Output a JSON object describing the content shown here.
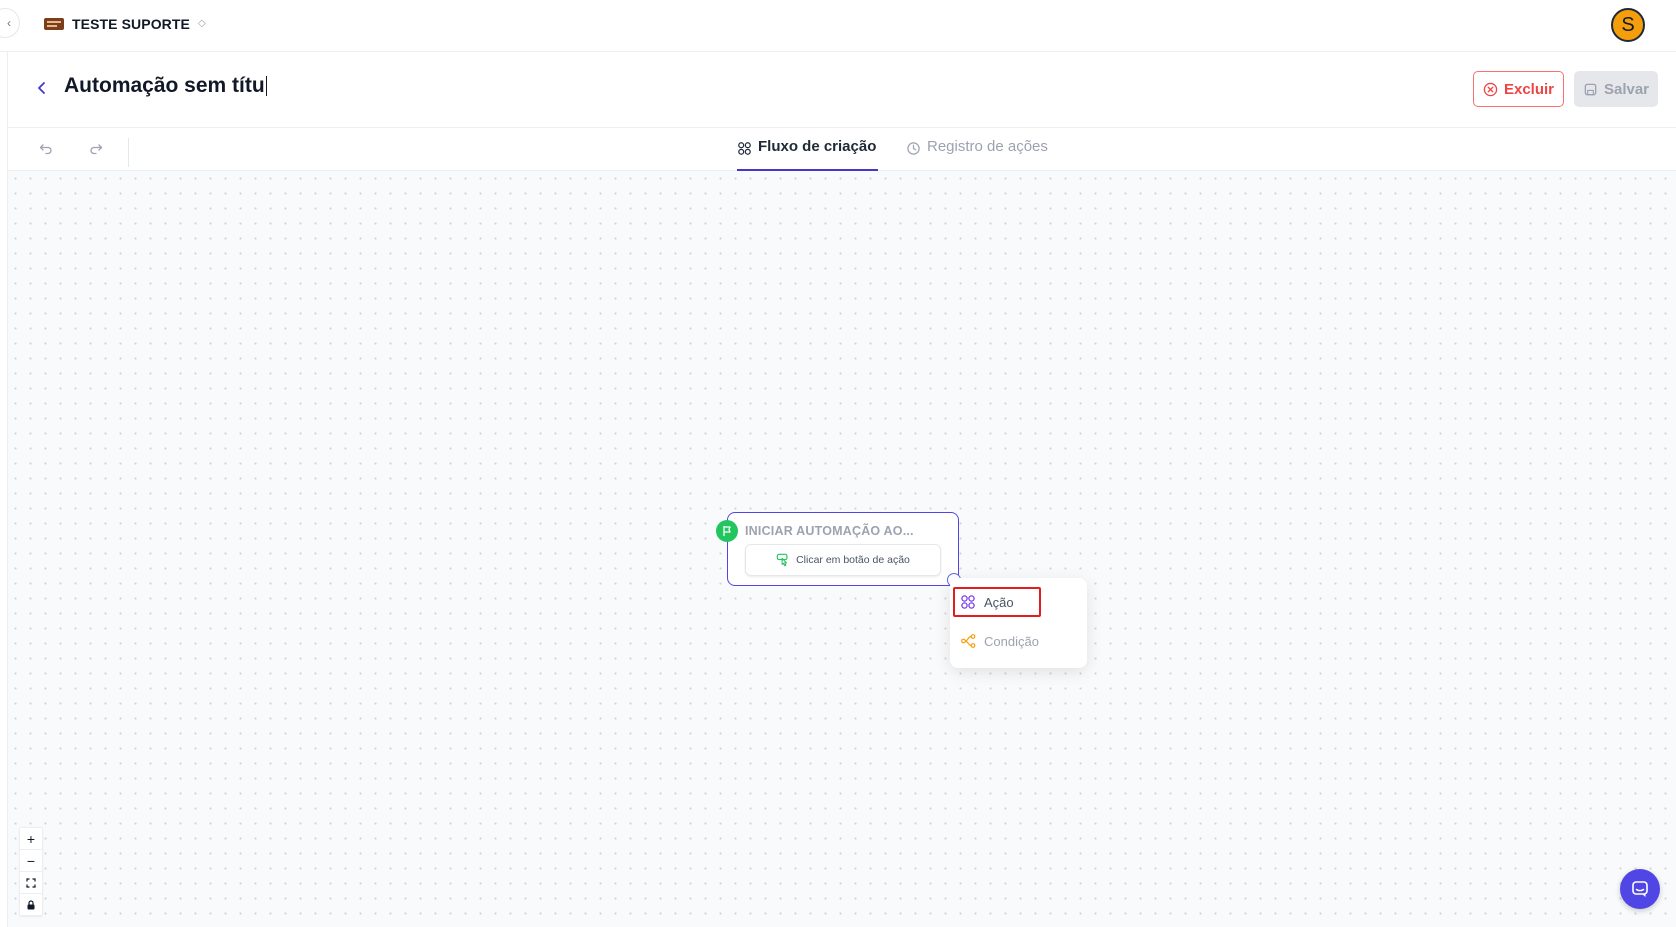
{
  "header": {
    "workspace_name": "TESTE SUPORTE",
    "avatar_initial": "S"
  },
  "automation": {
    "title": "Automação sem títu",
    "delete_label": "Excluir",
    "save_label": "Salvar"
  },
  "tabs": [
    {
      "label": "Fluxo de criação",
      "active": true
    },
    {
      "label": "Registro de ações",
      "active": false
    }
  ],
  "node": {
    "title": "INICIAR AUTOMAÇÃO AO...",
    "trigger": "Clicar em botão de ação"
  },
  "menu": {
    "items": [
      {
        "label": "Ação",
        "icon": "grid-icon"
      },
      {
        "label": "Condição",
        "icon": "branch-icon"
      }
    ]
  },
  "colors": {
    "accent": "#4338ca",
    "danger": "#ef4444",
    "success": "#22c55e",
    "avatar": "#f59e0b",
    "highlight": "#e11d1d"
  }
}
